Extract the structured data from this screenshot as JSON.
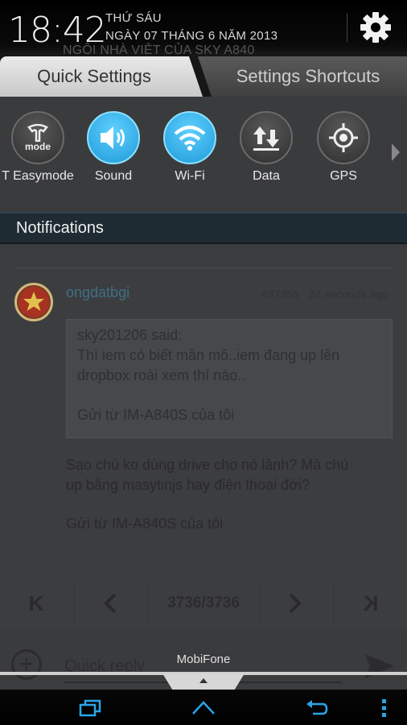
{
  "status": {
    "time": "18:42",
    "day": "THỨ SÁU",
    "date": "NGÀY 07 THÁNG 6 NĂM 2013",
    "underlying_title": "NGÔI NHÀ VIỆT CỦA SKY A840"
  },
  "tabs": {
    "quick_settings": "Quick Settings",
    "settings_shortcuts": "Settings Shortcuts"
  },
  "quick_settings": [
    {
      "label": "T Easymode",
      "icon": "t-easymode-icon",
      "state": "off"
    },
    {
      "label": "Sound",
      "icon": "speaker-icon",
      "state": "on"
    },
    {
      "label": "Wi-Fi",
      "icon": "wifi-icon",
      "state": "on"
    },
    {
      "label": "Data",
      "icon": "data-arrows-icon",
      "state": "off"
    },
    {
      "label": "GPS",
      "icon": "gps-icon",
      "state": "off"
    }
  ],
  "quick_settings_extra": {
    "easymode_badge": "mode"
  },
  "notifications": {
    "title": "Notifications"
  },
  "post": {
    "author": "ongdatbgi",
    "number": "#37358",
    "time": "24 seconds ago",
    "quote_lines": [
      "sky201206 said:",
      "Thì iem có biết mần mô..iem đang up lên",
      "dropbox roài xem thí nào..",
      "",
      "Gửi từ IM-A840S của tôi"
    ],
    "body_lines": [
      "Sao chú ko dùng drive cho nó lành? Mà chú",
      "up bằng masytinjs hay điện thoại đới?",
      "",
      "Gửi từ IM-A840S của tôi"
    ]
  },
  "pager": {
    "page": "3736/3736",
    "first": "K",
    "last": "K"
  },
  "reply": {
    "placeholder": "Quick reply"
  },
  "carrier": "MobiFone",
  "colors": {
    "accent_on": "#2aa9e6",
    "notif_header": "#1f2b33"
  }
}
